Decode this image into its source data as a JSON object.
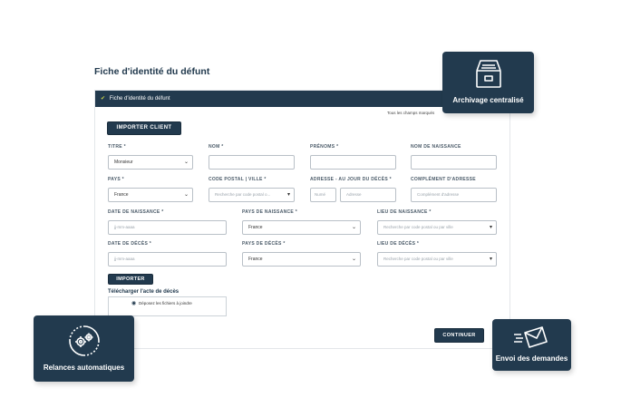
{
  "page": {
    "title": "Fiche d'identité du défunt"
  },
  "panel": {
    "header": "Fiche d'identité du défunt",
    "required_note": "Tous les champs marqués",
    "import_client_label": "IMPORTER CLIENT",
    "import_label": "IMPORTER",
    "continue_label": "CONTINUER"
  },
  "form": {
    "titre": {
      "label": "TITRE *",
      "value": "Monsieur"
    },
    "nom": {
      "label": "NOM *",
      "value": ""
    },
    "prenoms": {
      "label": "PRÉNOMS *",
      "value": ""
    },
    "nom_naissance": {
      "label": "NOM DE NAISSANCE",
      "value": ""
    },
    "pays": {
      "label": "PAYS *",
      "value": "France"
    },
    "code_postal": {
      "label": "CODE POSTAL | VILLE *",
      "placeholder": "Recherche par code postal o..."
    },
    "adresse": {
      "label": "ADRESSE - AU JOUR DU DÉCÈS *",
      "numero_placeholder": "Numé",
      "adresse_placeholder": "Adresse"
    },
    "complement": {
      "label": "COMPLÉMENT D'ADRESSE",
      "placeholder": "Complément d'adresse"
    },
    "date_naissance": {
      "label": "DATE DE NAISSANCE *",
      "placeholder": "jj-mm-aaaa"
    },
    "pays_naissance": {
      "label": "PAYS DE NAISSANCE *",
      "value": "France"
    },
    "lieu_naissance": {
      "label": "LIEU DE NAISSANCE *",
      "placeholder": "Recherche par code postal ou par ville"
    },
    "date_deces": {
      "label": "DATE DE DÉCÈS *",
      "placeholder": "jj-mm-aaaa"
    },
    "pays_deces": {
      "label": "PAYS DE DÉCÈS *",
      "value": "France"
    },
    "lieu_deces": {
      "label": "LIEU DE DÉCÈS *",
      "placeholder": "Recherche par code postal ou par ville"
    }
  },
  "upload": {
    "title": "Télécharger l'acte de décès",
    "dropzone_text": "Déposez les fichiers à joindre"
  },
  "badges": {
    "archive": "Archivage centralisé",
    "relances": "Relances automatiques",
    "envoi": "Envoi des demandes"
  },
  "colors": {
    "brand": "#223a4e",
    "accent": "#c9d24a"
  },
  "icons": {
    "archive": "archive-drawer-icon",
    "relances": "gears-cycle-icon",
    "envoi": "sending-envelope-icon"
  }
}
